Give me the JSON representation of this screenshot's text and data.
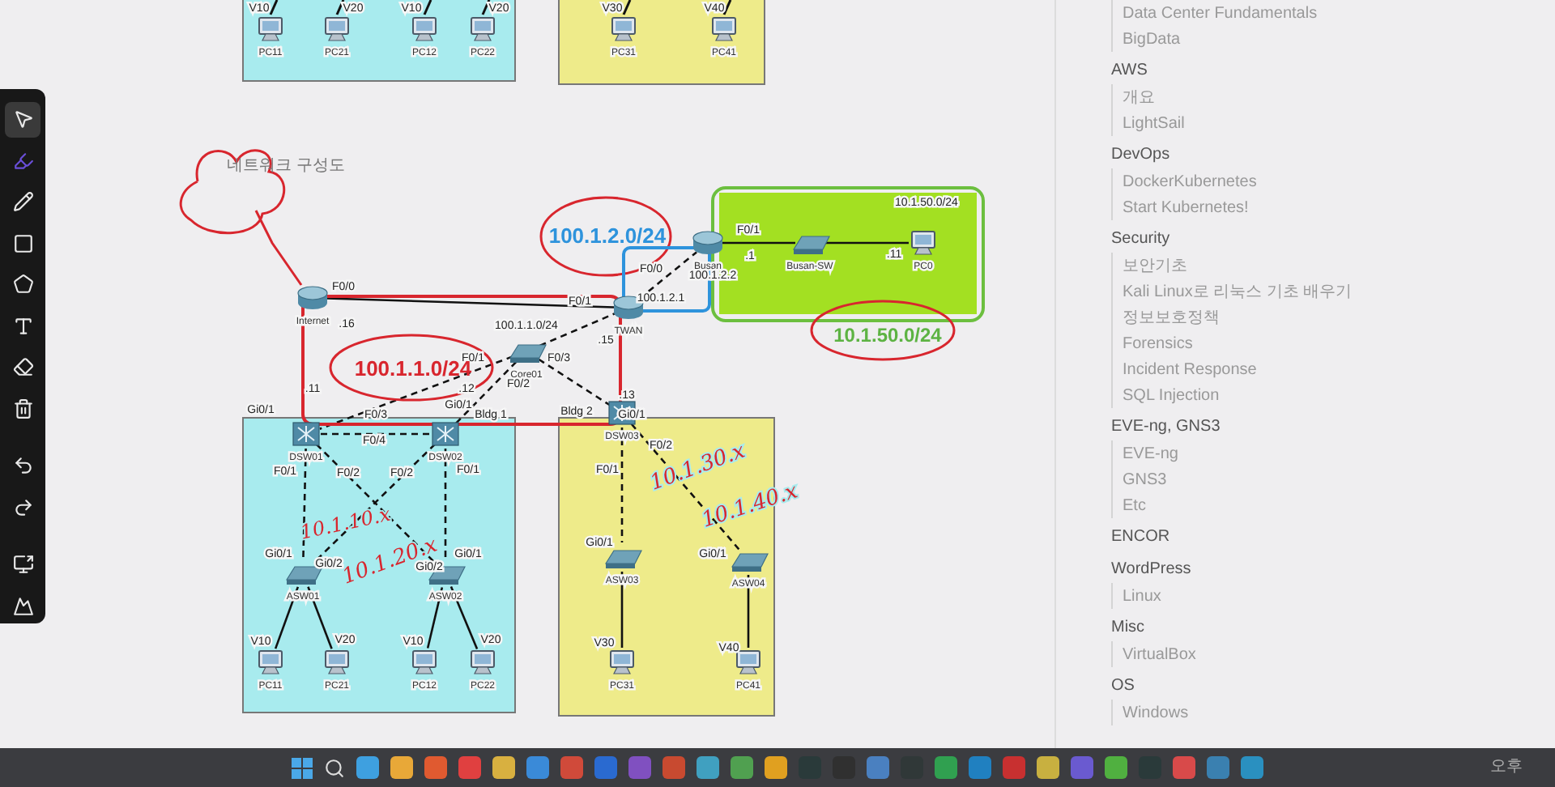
{
  "toolbar": {
    "tools": [
      {
        "kind": "select",
        "selected": true
      },
      {
        "kind": "marker",
        "selected": false
      },
      {
        "kind": "pen",
        "selected": false
      },
      {
        "kind": "rectangle",
        "selected": false
      },
      {
        "kind": "shape",
        "selected": false
      },
      {
        "kind": "text",
        "selected": false
      },
      {
        "kind": "eraser",
        "selected": false
      },
      {
        "kind": "delete",
        "selected": false
      },
      {
        "kind": "undo",
        "selected": false
      },
      {
        "kind": "redo",
        "selected": false
      },
      {
        "kind": "screen",
        "selected": false
      },
      {
        "kind": "collapse",
        "selected": false
      }
    ]
  },
  "diagram": {
    "title": "네트워크 구성도",
    "devices": [
      {
        "label": "PC11",
        "kind": "pc"
      },
      {
        "label": "PC21",
        "kind": "pc"
      },
      {
        "label": "PC12",
        "kind": "pc"
      },
      {
        "label": "PC22",
        "kind": "pc"
      },
      {
        "label": "PC31",
        "kind": "pc"
      },
      {
        "label": "PC41",
        "kind": "pc"
      },
      {
        "label": "Internet",
        "kind": "router"
      },
      {
        "label": "Core01",
        "kind": "switch"
      },
      {
        "label": "TWAN",
        "kind": "router"
      },
      {
        "label": "Busan",
        "kind": "router"
      },
      {
        "label": "Busan-SW",
        "kind": "switch"
      },
      {
        "label": "PC0",
        "kind": "pc"
      },
      {
        "label": "DSW01",
        "kind": "multilayer"
      },
      {
        "label": "DSW02",
        "kind": "multilayer"
      },
      {
        "label": "DSW03",
        "kind": "multilayer"
      },
      {
        "label": "ASW01",
        "kind": "switch"
      },
      {
        "label": "ASW02",
        "kind": "switch"
      },
      {
        "label": "ASW03",
        "kind": "switch"
      },
      {
        "label": "ASW04",
        "kind": "switch"
      },
      {
        "label": "PC11",
        "kind": "pc"
      },
      {
        "label": "PC21",
        "kind": "pc"
      },
      {
        "label": "PC12",
        "kind": "pc"
      },
      {
        "label": "PC22",
        "kind": "pc"
      },
      {
        "label": "PC31",
        "kind": "pc"
      },
      {
        "label": "PC41",
        "kind": "pc"
      }
    ],
    "port_labels": [
      "V10",
      "V20",
      "V10",
      "V20",
      "V30",
      "V40",
      "F0/0",
      ".16",
      ".11",
      "F0/1",
      "F0/2",
      "F0/3",
      ".12",
      "100.1.1.0/24",
      "F0/1",
      ".15",
      "F0/0",
      "100.1.2.1",
      "100.1.2.2",
      "F0/1",
      ".1",
      ".11",
      "10.1.50.0/24",
      ".13",
      "Gi0/1",
      "F0/3",
      "Gi0/1",
      "Bldg 1",
      "Bldg 2",
      "Gi0/1",
      "F0/4",
      "F0/1",
      "F0/2",
      "F0/2",
      "F0/1",
      "F0/1",
      "F0/2",
      "Gi0/1",
      "Gi0/2",
      "Gi0/2",
      "Gi0/1",
      "Gi0/1",
      "Gi0/1",
      "V10",
      "V20",
      "V10",
      "V20",
      "V30",
      "V40"
    ],
    "annotations": [
      {
        "text": "100.1.1.0/24",
        "kind": "label",
        "color": "#d8262e"
      },
      {
        "text": "100.1.2.0/24",
        "kind": "label",
        "color": "#2e93dc"
      },
      {
        "text": "10.1.50.0/24",
        "kind": "label",
        "color": "#5db343"
      },
      {
        "text": "10.1.10.x",
        "kind": "handwritten",
        "color": "#d8262e"
      },
      {
        "text": "10.1.20.x",
        "kind": "handwritten",
        "color": "#d8262e"
      },
      {
        "text": "10.1.30.x",
        "kind": "handwritten",
        "color": "#d8262e"
      },
      {
        "text": "10.1.40.x",
        "kind": "handwritten",
        "color": "#d8262e"
      }
    ]
  },
  "sidebar": {
    "sections": [
      {
        "items": [
          "Data Center Fundamentals",
          "BigData"
        ]
      },
      {
        "title": "AWS",
        "items": [
          "개요",
          "LightSail"
        ]
      },
      {
        "title": "DevOps",
        "items": [
          "DockerKubernetes",
          "Start Kubernetes!"
        ]
      },
      {
        "title": "Security",
        "items": [
          "보안기초",
          "Kali Linux로 리눅스 기초 배우기",
          "정보보호정책",
          "Forensics",
          "Incident Response",
          "SQL Injection"
        ]
      },
      {
        "title": "EVE-ng, GNS3",
        "items": [
          "EVE-ng",
          "GNS3",
          "Etc"
        ]
      },
      {
        "title": "ENCOR"
      },
      {
        "title": "WordPress",
        "items": [
          "Linux"
        ]
      },
      {
        "title": "Misc",
        "items": [
          "VirtualBox"
        ]
      },
      {
        "title": "OS",
        "items": [
          "Windows"
        ]
      }
    ]
  },
  "taskbar": {
    "clock": "오후"
  }
}
